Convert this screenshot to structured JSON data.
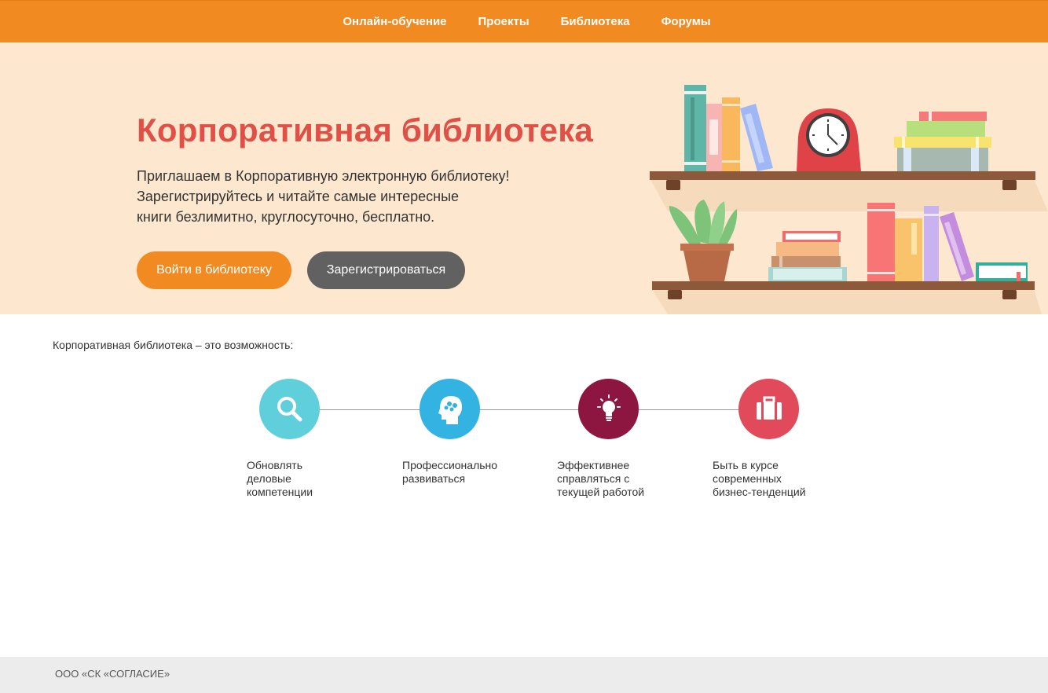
{
  "nav": {
    "items": [
      {
        "label": "Онлайн-обучение"
      },
      {
        "label": "Проекты"
      },
      {
        "label": "Библиотека"
      },
      {
        "label": "Форумы"
      }
    ],
    "background_color": "#f18a21"
  },
  "hero": {
    "title": "Корпоративная библиотека",
    "text_lines": [
      "Приглашаем в Корпоративную электронную библиотеку!",
      "Зарегистрируйтесь и читайте самые интересные",
      "книги безлимитно, круглосуточно, бесплатно."
    ],
    "login_button": "Войти в библиотеку",
    "register_button": "Зарегистрироваться",
    "illustration": "bookshelves-illustration",
    "title_color": "#e05047",
    "background_color": "#fde8cf"
  },
  "intro": {
    "text": "Корпоративная библиотека – это возможность:"
  },
  "features": [
    {
      "icon": "magnifier-icon",
      "color": "#5fcfdc",
      "lines": [
        "Обновлять",
        "деловые",
        "компетенции"
      ]
    },
    {
      "icon": "brain-head-icon",
      "color": "#33b3e2",
      "lines": [
        "Профессионально",
        "развиваться"
      ]
    },
    {
      "icon": "lightbulb-icon",
      "color": "#8d1640",
      "lines": [
        "Эффективнее",
        "справляться с",
        "текущей работой"
      ]
    },
    {
      "icon": "briefcase-icon",
      "color": "#e04a5a",
      "lines": [
        "Быть в курсе",
        "современных",
        "бизнес-тенденций"
      ]
    }
  ],
  "footer": {
    "text": "ООО «СК «СОГЛАСИЕ»"
  }
}
